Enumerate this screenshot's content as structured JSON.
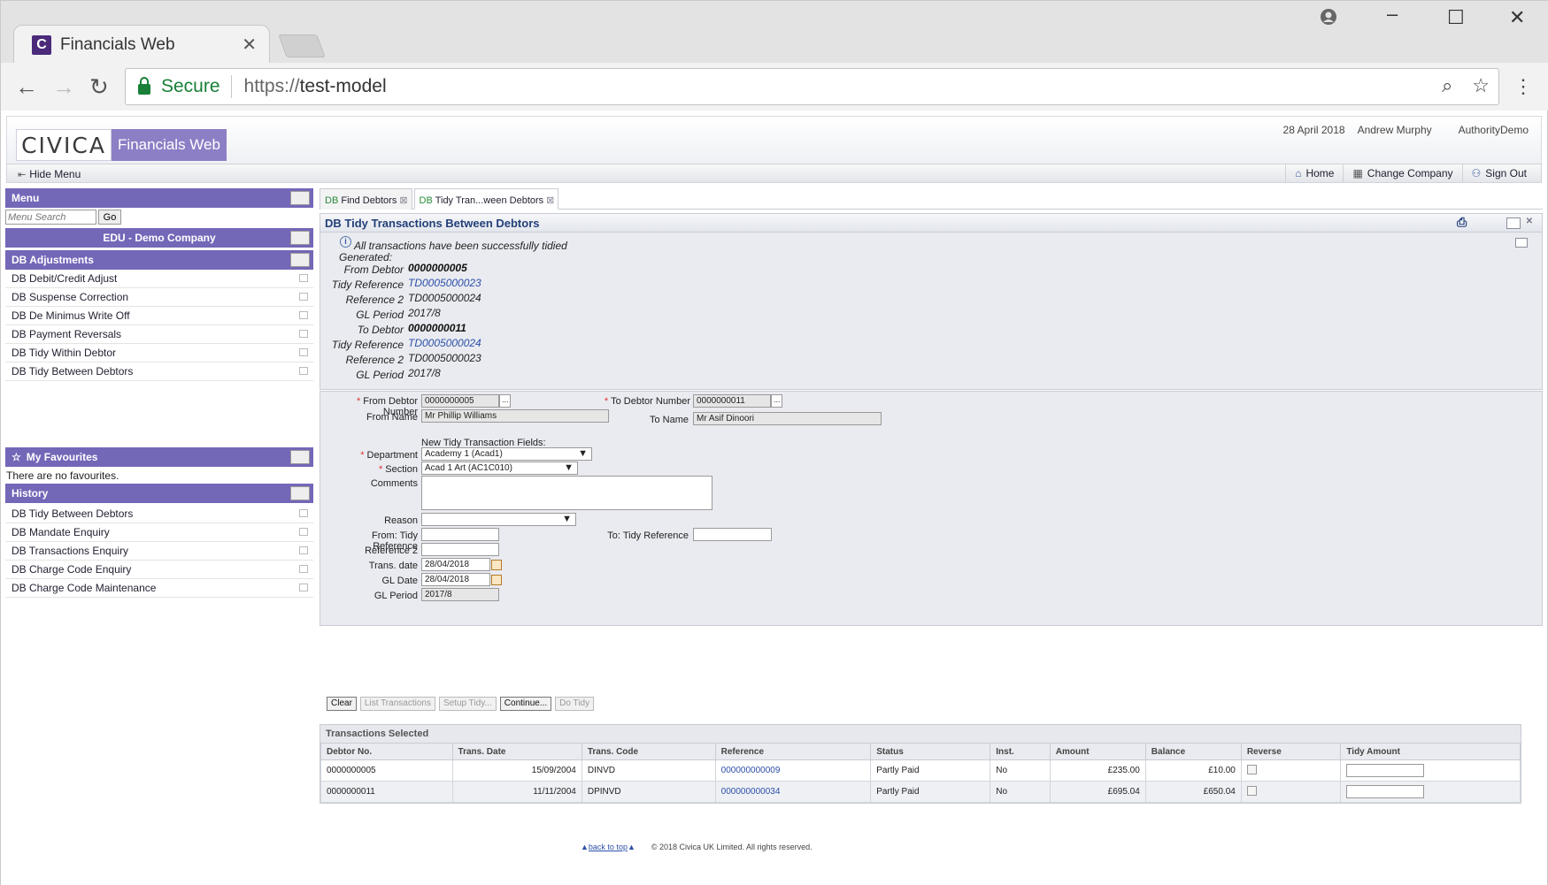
{
  "browser": {
    "tab_title": "Financials Web",
    "tab_close": "✕",
    "secure_label": "Secure",
    "url_protocol": "https://",
    "url_host": "test-model"
  },
  "header": {
    "logo_text": "CIVICA",
    "app_name": "Financials Web",
    "date": "28 April 2018",
    "user": "Andrew Murphy",
    "authority": "AuthorityDemo"
  },
  "menubar": {
    "hide_menu": "Hide Menu",
    "home": "Home",
    "change_company": "Change Company",
    "sign_out": "Sign Out"
  },
  "sidebar": {
    "menu_title": "Menu",
    "search_placeholder": "Menu Search",
    "go_label": "Go",
    "company": "EDU - Demo Company",
    "adjustments_title": "DB Adjustments",
    "adjustments": [
      "DB Debit/Credit Adjust",
      "DB Suspense Correction",
      "DB De Minimus Write Off",
      "DB Payment Reversals",
      "DB Tidy Within Debtor",
      "DB Tidy Between Debtors"
    ],
    "favourites_title": "My Favourites",
    "favourites_empty": "There are no favourites.",
    "history_title": "History",
    "history": [
      "DB Tidy Between Debtors",
      "DB Mandate Enquiry",
      "DB Transactions Enquiry",
      "DB Charge Code Enquiry",
      "DB Charge Code Maintenance"
    ]
  },
  "content_tabs": [
    {
      "prefix": "DB",
      "label": "Find Debtors"
    },
    {
      "prefix": "DB",
      "label": "Tidy Tran...ween Debtors"
    }
  ],
  "page_title": "DB Tidy Transactions Between Debtors",
  "result": {
    "message": "All transactions have been successfully tidied",
    "generated_label": "Generated:",
    "rows": [
      {
        "label": "From Debtor",
        "value": "0000000005",
        "style": "b"
      },
      {
        "label": "Tidy Reference",
        "value": "TD0005000023",
        "style": "link"
      },
      {
        "label": "Reference 2",
        "value": "TD0005000024",
        "style": ""
      },
      {
        "label": "GL Period",
        "value": "2017/8",
        "style": ""
      },
      {
        "label": "To Debtor",
        "value": "0000000011",
        "style": "b"
      },
      {
        "label": "Tidy Reference",
        "value": "TD0005000024",
        "style": "link"
      },
      {
        "label": "Reference 2",
        "value": "TD0005000023",
        "style": ""
      },
      {
        "label": "GL Period",
        "value": "2017/8",
        "style": ""
      }
    ]
  },
  "form": {
    "from_debtor_label": "From Debtor Number",
    "from_debtor_value": "0000000005",
    "to_debtor_label": "To Debtor Number",
    "to_debtor_value": "0000000011",
    "from_name_label": "From Name",
    "from_name_value": "Mr  Phillip  Williams",
    "to_name_label": "To Name",
    "to_name_value": "Mr Asif Dinoori",
    "new_fields_label": "New Tidy Transaction Fields:",
    "department_label": "Department",
    "department_value": "Academy 1 (Acad1)",
    "section_label": "Section",
    "section_value": "Acad 1 Art (AC1C010)",
    "comments_label": "Comments",
    "reason_label": "Reason",
    "from_tidy_ref_label": "From: Tidy Reference",
    "to_tidy_ref_label": "To: Tidy Reference",
    "reference2_label": "Reference 2",
    "trans_date_label": "Trans. date",
    "trans_date_value": "28/04/2018",
    "gl_date_label": "GL Date",
    "gl_date_value": "28/04/2018",
    "gl_period_label": "GL Period",
    "gl_period_value": "2017/8",
    "lookup_btn": "..."
  },
  "buttons": {
    "clear": "Clear",
    "list_transactions": "List Transactions",
    "setup_tidy": "Setup Tidy...",
    "continue": "Continue...",
    "do_tidy": "Do Tidy"
  },
  "table": {
    "title": "Transactions Selected",
    "columns": [
      "Debtor No.",
      "Trans. Date",
      "Trans. Code",
      "Reference",
      "Status",
      "Inst.",
      "Amount",
      "Balance",
      "Reverse",
      "Tidy Amount"
    ],
    "rows": [
      [
        "0000000005",
        "15/09/2004",
        "DINVD",
        "000000000009",
        "Partly Paid",
        "No",
        "£235.00",
        "£10.00"
      ],
      [
        "0000000011",
        "11/11/2004",
        "DPINVD",
        "000000000034",
        "Partly Paid",
        "No",
        "£695.04",
        "£650.04"
      ]
    ]
  },
  "footer": {
    "back_to_top": "back to top",
    "copyright": "© 2018 Civica UK Limited. All rights reserved."
  }
}
